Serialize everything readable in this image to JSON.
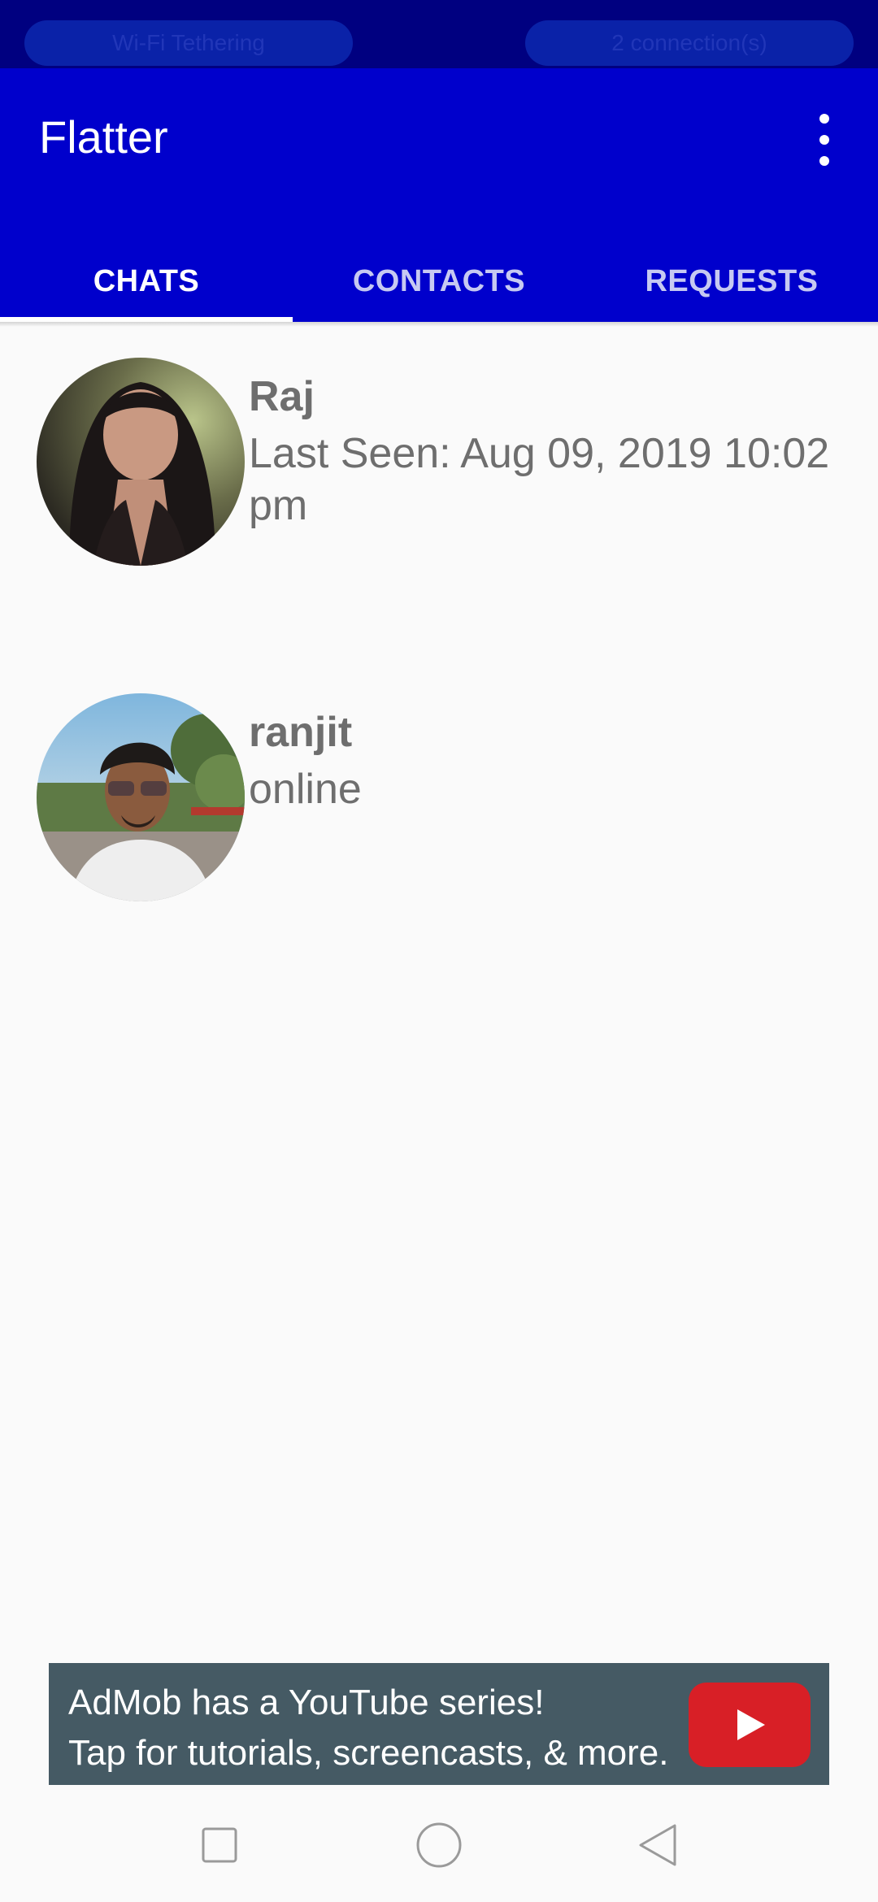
{
  "status_bar": {
    "left_pill": "Wi-Fi Tethering",
    "right_pill": "2 connection(s)"
  },
  "app_bar": {
    "title": "Flatter",
    "menu_icon": "more-vert-icon"
  },
  "tabs": [
    {
      "label": "CHATS",
      "active": true
    },
    {
      "label": "CONTACTS",
      "active": false
    },
    {
      "label": "REQUESTS",
      "active": false
    }
  ],
  "chats": [
    {
      "name": "Raj",
      "status": "Last Seen: Aug 09, 2019 10:02 pm"
    },
    {
      "name": "ranjit",
      "status": "online"
    }
  ],
  "ad": {
    "line1": "AdMob has a YouTube series!",
    "line2": "Tap for tutorials, screencasts, & more.",
    "icon": "youtube-play-icon"
  },
  "nav_bar": {
    "icons": [
      "recents-square-icon",
      "home-circle-icon",
      "back-triangle-icon"
    ]
  },
  "colors": {
    "app_bar": "#0000cc",
    "status_bar": "#000080",
    "tab_inactive": "#c6c9f2",
    "ad_background": "#455a64",
    "youtube_red": "#d81f26"
  }
}
